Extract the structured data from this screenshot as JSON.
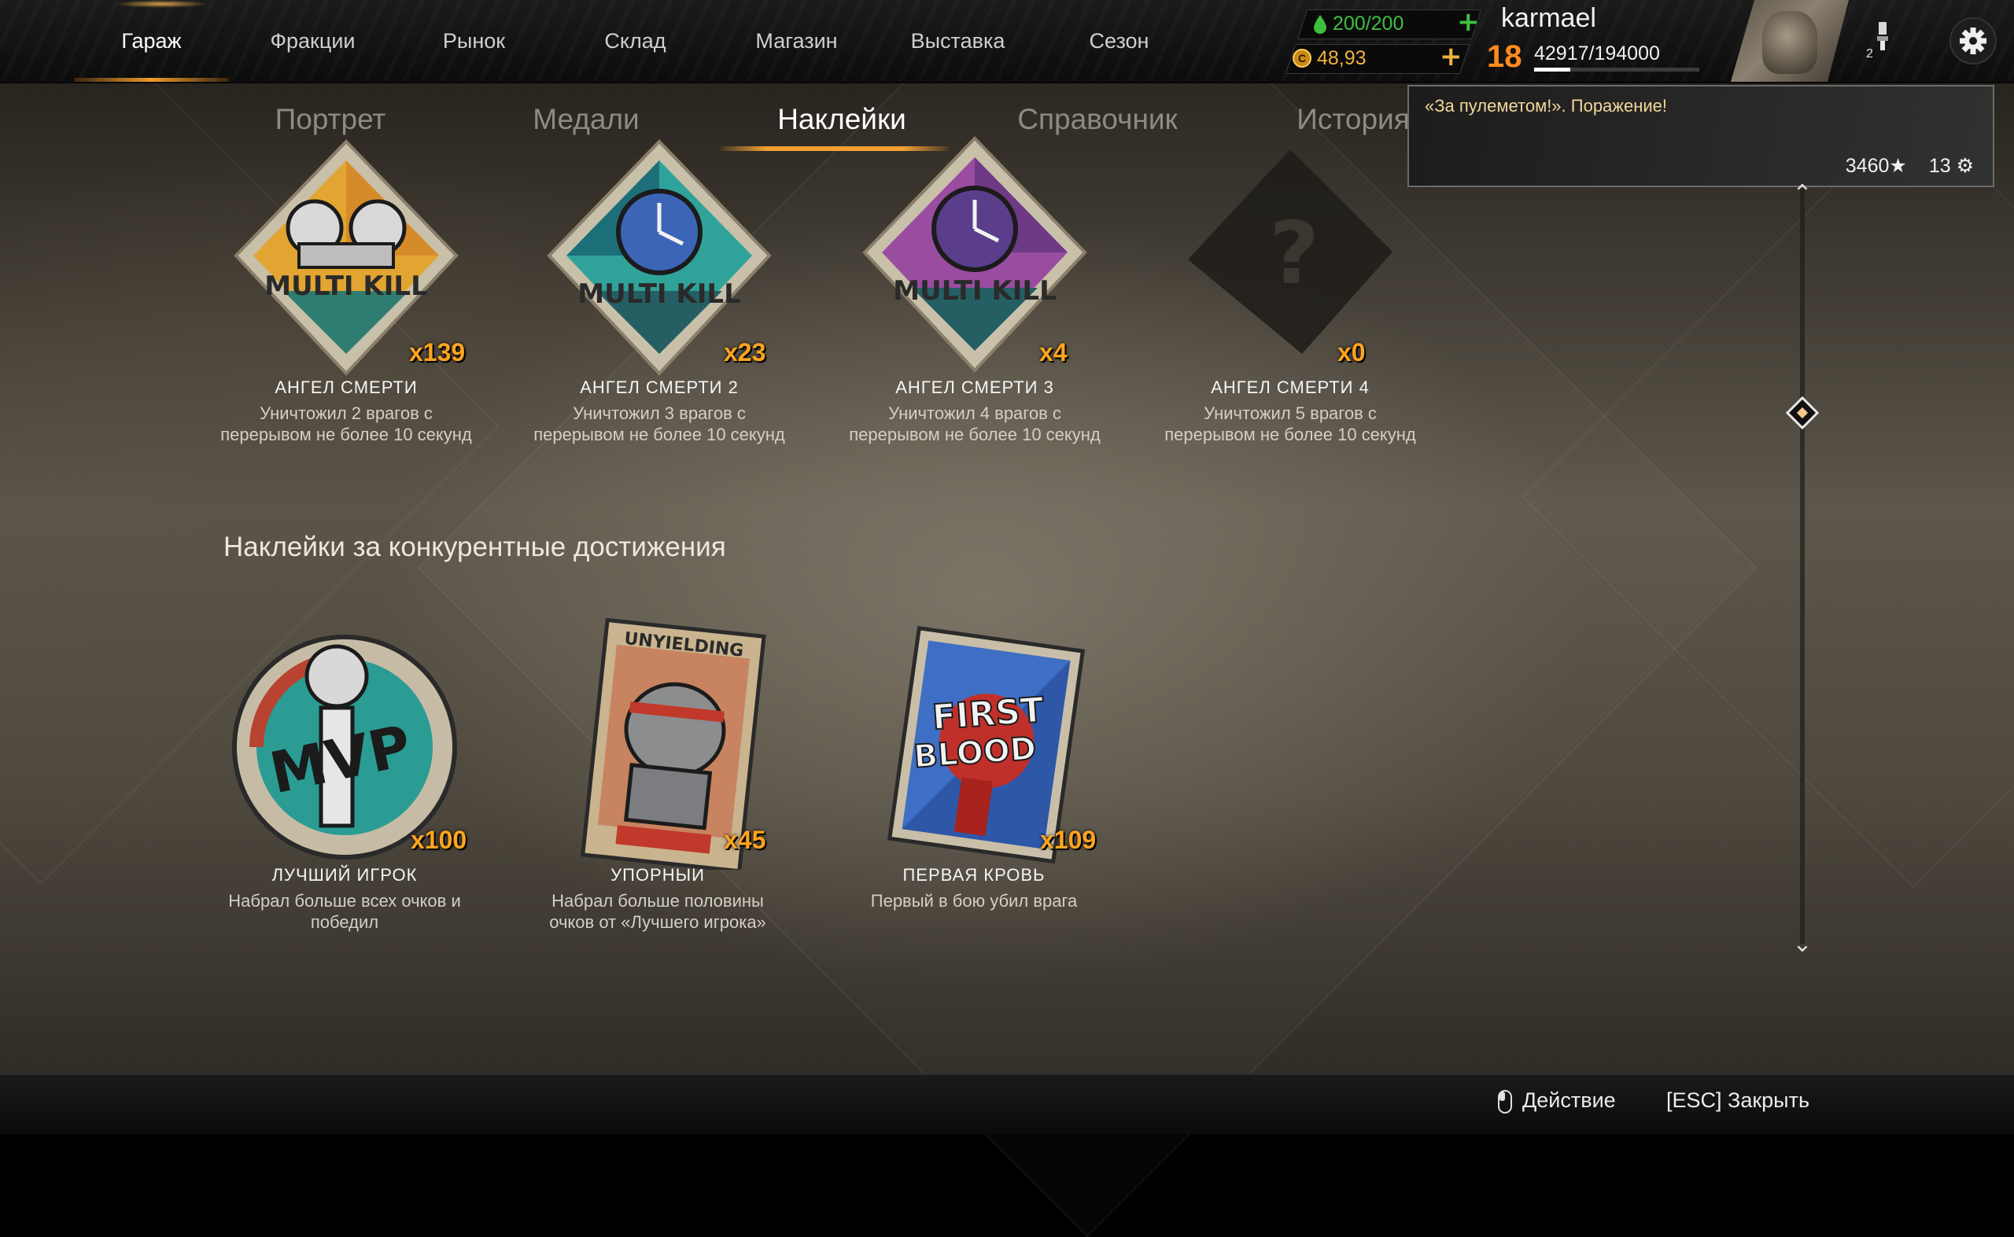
{
  "nav": {
    "items": [
      "Гараж",
      "Фракции",
      "Рынок",
      "Склад",
      "Магазин",
      "Выставка",
      "Сезон"
    ],
    "active_index": 0
  },
  "resources": {
    "fuel": "200/200",
    "coins": "48,93"
  },
  "player": {
    "name": "karmael",
    "level": "18",
    "xp": "42917/194000",
    "xp_progress": 0.221,
    "badge_count": "2"
  },
  "subtabs": {
    "items": [
      "Портрет",
      "Медали",
      "Наклейки",
      "Справочник",
      "История"
    ],
    "active_index": 2
  },
  "notification": {
    "message": "«За пулеметом!». Поражение!",
    "stars": "3460",
    "parts": "13"
  },
  "stickers_row1": [
    {
      "count": "x139",
      "name": "АНГЕЛ СМЕРТИ",
      "desc_line1": "Уничтожил 2 врагов с",
      "desc_line2": "перерывом не более 10 секунд",
      "art": "multi-kill-yellow",
      "art_text": "MULTI KILL"
    },
    {
      "count": "x23",
      "name": "АНГЕЛ СМЕРТИ 2",
      "desc_line1": "Уничтожил 3 врагов с",
      "desc_line2": "перерывом не более 10 секунд",
      "art": "multi-kill-teal",
      "art_text": "MULTI KILL"
    },
    {
      "count": "x4",
      "name": "АНГЕЛ СМЕРТИ 3",
      "desc_line1": "Уничтожил 4 врагов с",
      "desc_line2": "перерывом не более 10 секунд",
      "art": "multi-kill-purple",
      "art_text": "MULTI KILL"
    },
    {
      "count": "x0",
      "name": "АНГЕЛ СМЕРТИ 4",
      "desc_line1": "Уничтожил 5 врагов с",
      "desc_line2": "перерывом не более 10 секунд",
      "art": "locked-question",
      "art_text": "?"
    }
  ],
  "section_title": "Наклейки за конкурентные достижения",
  "stickers_row2": [
    {
      "count": "x100",
      "name": "ЛУЧШИЙ ИГРОК",
      "desc_line1": "Набрал больше всех очков и",
      "desc_line2": "победил",
      "art": "mvp-badge",
      "art_text": "MVP"
    },
    {
      "count": "x45",
      "name": "УПОРНЫЙ",
      "desc_line1": "Набрал больше половины",
      "desc_line2": "очков от «Лучшего игрока»",
      "art": "unyielding-rhino",
      "art_text": "UNYIELDING"
    },
    {
      "count": "x109",
      "name": "ПЕРВАЯ КРОВЬ",
      "desc_line1": "Первый в бою убил врага",
      "desc_line2": "",
      "art": "first-blood",
      "art_text": "FIRST BLOOD"
    }
  ],
  "bottom": {
    "action_label": "Действие",
    "close_label": "[ESC] Закрыть"
  },
  "colors": {
    "accent_orange": "#f3a033",
    "count_orange": "#ffa51f",
    "fuel_green": "#3fbf3f",
    "level_orange": "#ff8a1e"
  }
}
